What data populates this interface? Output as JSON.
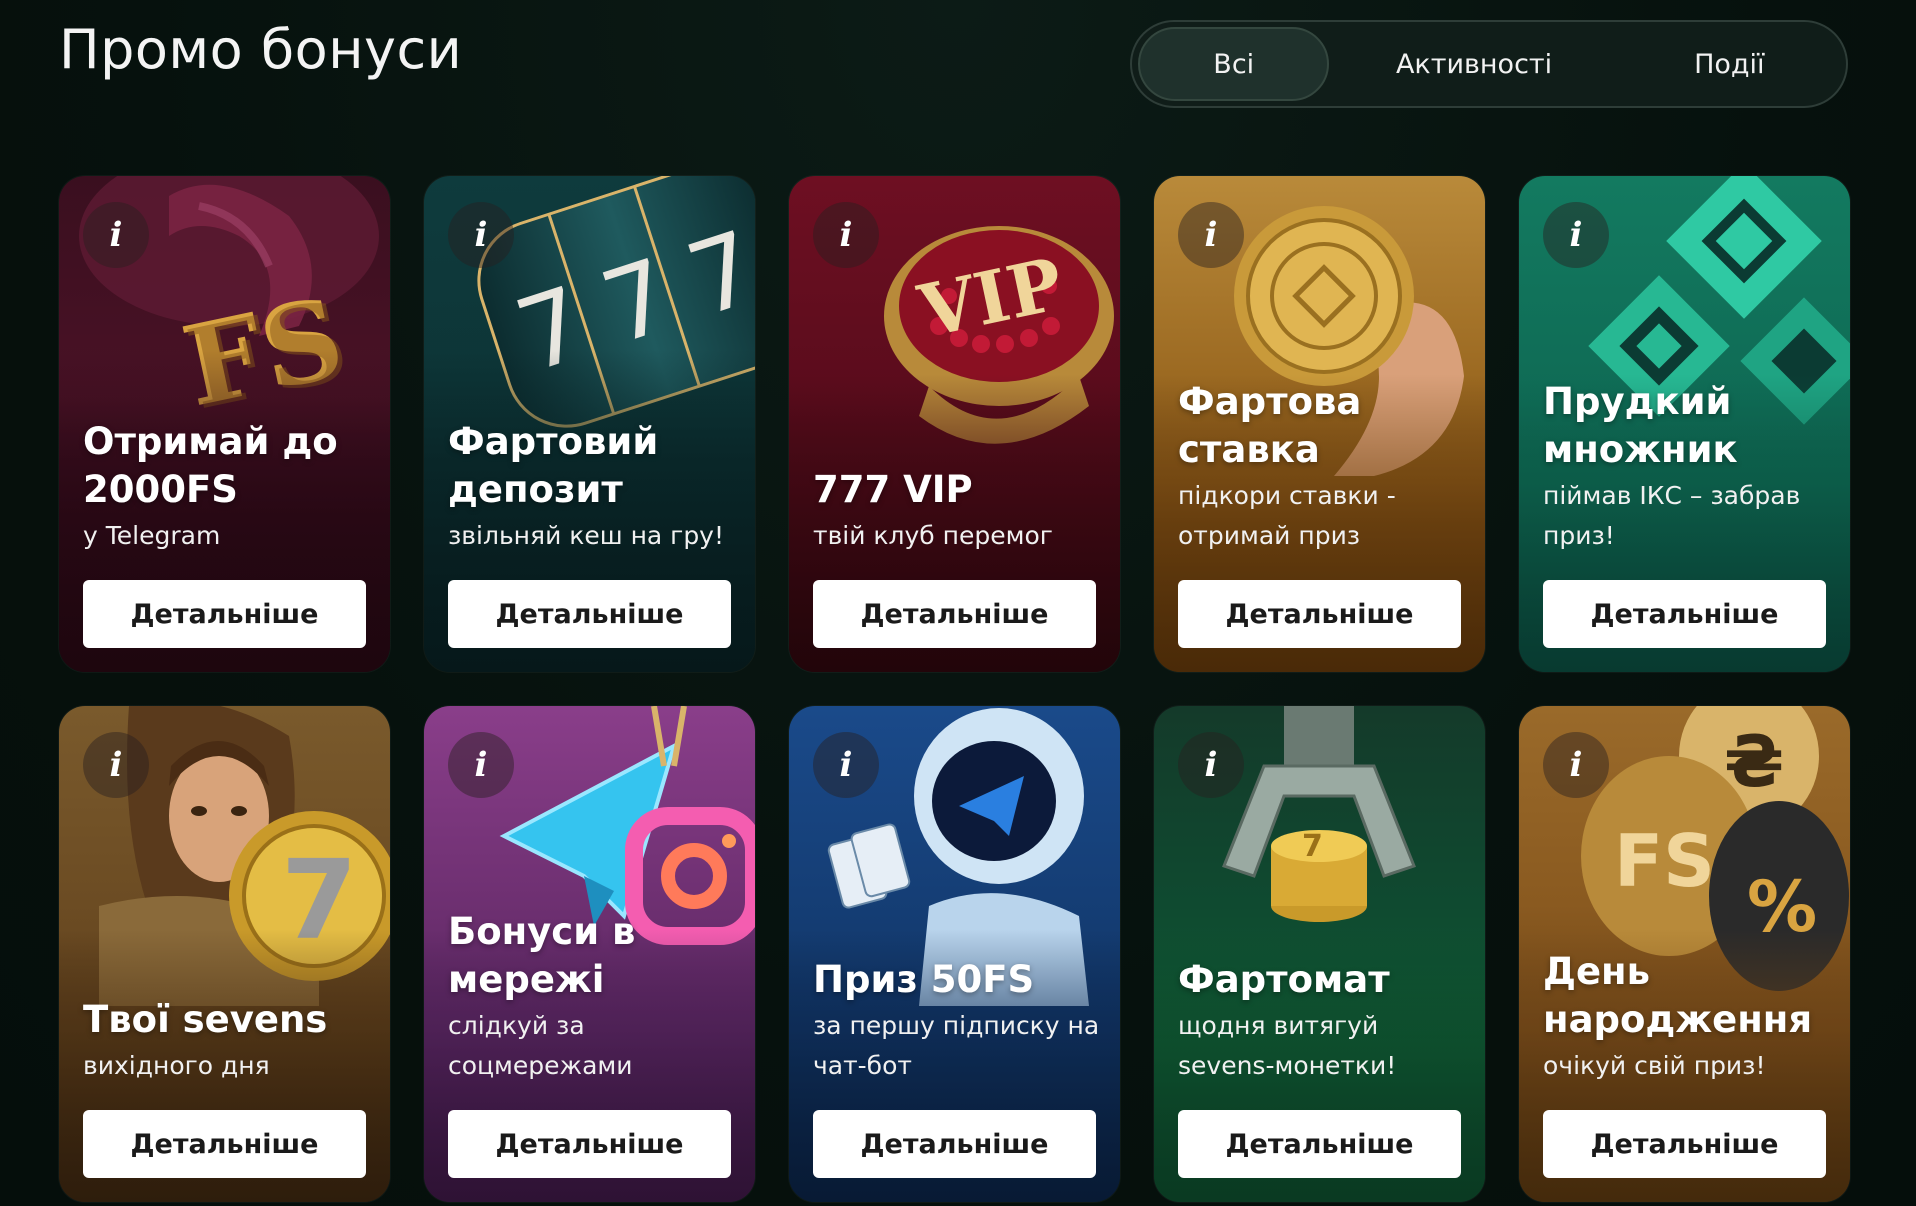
{
  "header": {
    "title": "Промо бонуси"
  },
  "tabs": [
    {
      "label": "Всі",
      "active": true
    },
    {
      "label": "Активності",
      "active": false
    },
    {
      "label": "Події",
      "active": false
    }
  ],
  "cards": [
    {
      "title": "Отримай до 2000FS",
      "subtitle": "у Telegram",
      "button": "Детальніше",
      "art": "fs-gold-letters-icon",
      "accent": "#5a1730"
    },
    {
      "title": "Фартовий депозит",
      "subtitle": "звільняй кеш на гру!",
      "button": "Детальніше",
      "art": "slot-reels-777-icon",
      "accent": "#0f4f4f"
    },
    {
      "title": "777 VIP",
      "subtitle": "твій клуб перемог",
      "button": "Детальніше",
      "art": "vip-ring-icon",
      "accent": "#6e0f22"
    },
    {
      "title": "Фартова ставка",
      "subtitle": "підкори ставки - отримай приз",
      "button": "Детальніше",
      "art": "gold-coin-icon",
      "accent": "#9a6418"
    },
    {
      "title": "Прудкий множник",
      "subtitle": "піймав ІКС – забрав приз!",
      "button": "Детальніше",
      "art": "diamond-blocks-icon",
      "accent": "#0f6b55"
    },
    {
      "title": "Твої sevens",
      "subtitle": "вихідного дня",
      "button": "Детальніше",
      "art": "woman-seven-coin-icon",
      "accent": "#6e4a20"
    },
    {
      "title": "Бонуси в мережі",
      "subtitle": "слідкуй за соцмережами",
      "button": "Детальніше",
      "art": "telegram-instagram-keychain-icon",
      "accent": "#6a2e6e"
    },
    {
      "title": "Приз 50FS",
      "subtitle": "за першу підписку на чат-бот",
      "button": "Детальніше",
      "art": "robot-telegram-icon",
      "accent": "#0f3c6e"
    },
    {
      "title": "Фартомат",
      "subtitle": "щодня витягуй sevens-монетки!",
      "button": "Детальніше",
      "art": "claw-machine-coins-icon",
      "accent": "#0f5a34"
    },
    {
      "title": "День народження",
      "subtitle": "очікуй свій приз!",
      "button": "Детальніше",
      "art": "balloons-fs-icon",
      "accent": "#7a4a18"
    }
  ]
}
